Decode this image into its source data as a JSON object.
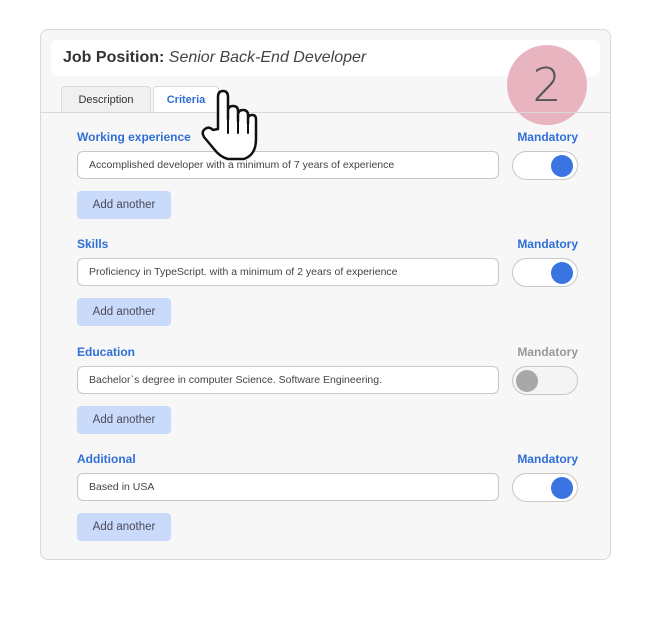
{
  "header": {
    "label": "Job Position:",
    "value": "Senior Back-End Developer",
    "step": "2"
  },
  "tabs": [
    {
      "label": "Description",
      "active": false
    },
    {
      "label": "Criteria",
      "active": true
    }
  ],
  "sections": [
    {
      "title": "Working experience",
      "mandatory_label": "Mandatory",
      "mandatory": true,
      "value": "Accomplished developer with a minimum of 7 years of experience",
      "button": "Add another"
    },
    {
      "title": "Skills",
      "mandatory_label": "Mandatory",
      "mandatory": true,
      "value": "Proficiency in TypeScript. with a minimum of 2 years of experience",
      "button": "Add another"
    },
    {
      "title": "Education",
      "mandatory_label": "Mandatory",
      "mandatory": false,
      "value": "Bachelor`s degree in computer Science. Software Engineering.",
      "button": "Add another"
    },
    {
      "title": "Additional",
      "mandatory_label": "Mandatory",
      "mandatory": true,
      "value": "Based in USA",
      "button": "Add another"
    }
  ],
  "colors": {
    "accent": "#2f6fd6",
    "toggle_on": "#3a73e2",
    "button_bg": "#c9dafb",
    "badge": "#e8b4c0"
  },
  "icons": {
    "cursor": "hand-pointer-icon"
  }
}
